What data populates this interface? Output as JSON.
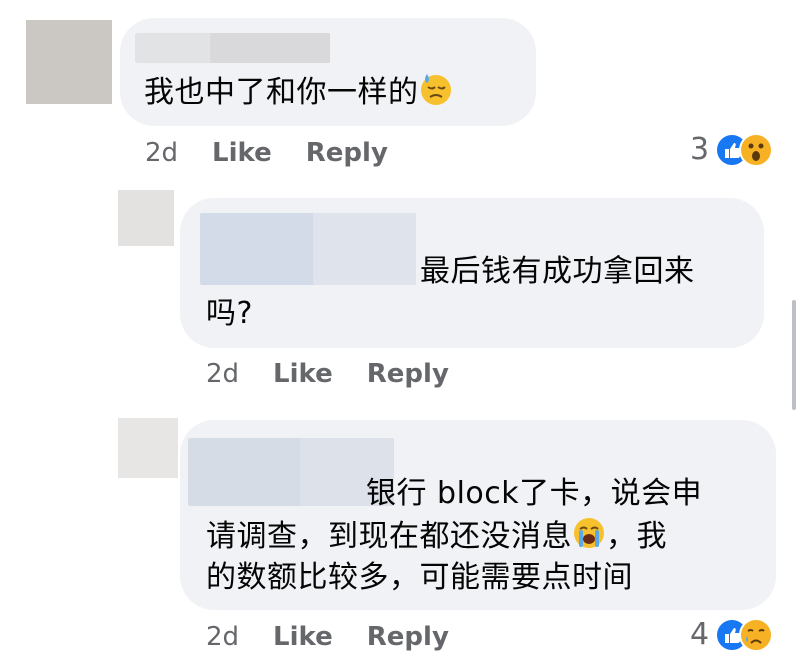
{
  "comments": [
    {
      "text": "我也中了和你一样的",
      "emoji": "downcast-face-with-sweat",
      "time": "2d",
      "like_label": "Like",
      "reply_label": "Reply",
      "reaction_count": "3",
      "reactions": [
        "like",
        "wow"
      ]
    },
    {
      "text_line1": "最后钱有成功拿回来",
      "text_line2": "吗?",
      "time": "2d",
      "like_label": "Like",
      "reply_label": "Reply"
    },
    {
      "text_line1": "银行 block了卡，说会申",
      "text_line2a": "请调查，到现在都还没消息",
      "text_line2b": "，我",
      "text_line3": "的数额比较多，可能需要点时间",
      "emoji": "loudly-crying-face",
      "time": "2d",
      "like_label": "Like",
      "reply_label": "Reply",
      "reaction_count": "4",
      "reactions": [
        "like",
        "sad"
      ]
    }
  ],
  "colors": {
    "bubble": "#f0f2f5",
    "meta_text": "#65676b",
    "like_blue": "#1877f2",
    "emoji_yellow": "#f7b125"
  }
}
